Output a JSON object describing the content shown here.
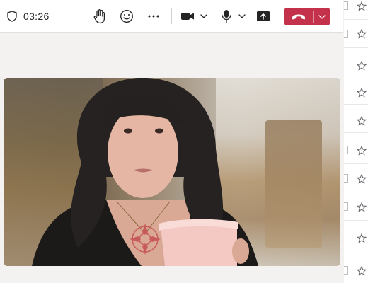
{
  "call": {
    "timer": "03:26",
    "icons": {
      "shield": "shield-icon",
      "raise_hand": "hand-icon",
      "react": "smiley-icon",
      "more": "more-icon",
      "camera": "video-camera-icon",
      "mic": "microphone-icon",
      "share": "share-screen-icon",
      "hangup": "phone-hangup-icon",
      "caret": "chevron-down-icon"
    },
    "colors": {
      "hangup_bg": "#c4314b",
      "toolbar_bg": "#ffffff",
      "stage_bg": "#f3f2f1"
    }
  },
  "side_list": {
    "row_count": 10,
    "star_icon": "star-outline-icon"
  }
}
